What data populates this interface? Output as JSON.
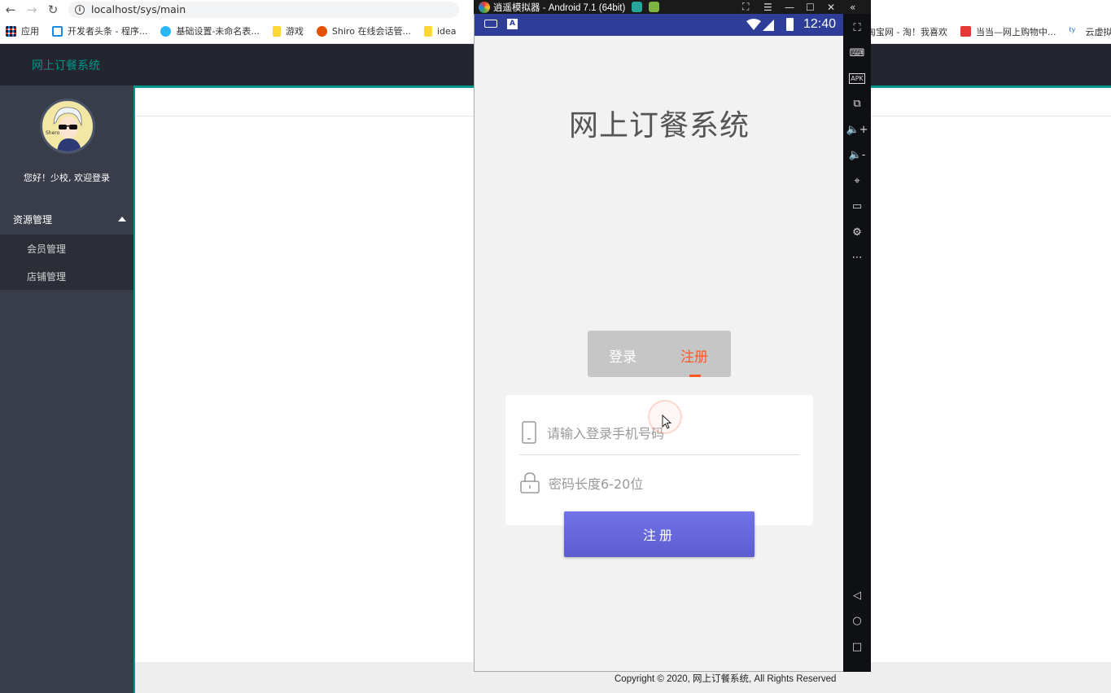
{
  "browser": {
    "url": "localhost/sys/main",
    "bookmarks": [
      {
        "label": "应用",
        "icon": "apps-grid-icon",
        "color": "#e53935"
      },
      {
        "label": "开发者头条 - 程序...",
        "icon": "toutiao-icon",
        "color": "#1e88e5"
      },
      {
        "label": "基础设置-未命名表...",
        "icon": "cloud-icon",
        "color": "#29b6f6"
      },
      {
        "label": "游戏",
        "icon": "folder-icon",
        "color": "#fdd835"
      },
      {
        "label": "Shiro 在线会话管...",
        "icon": "shiro-icon",
        "color": "#e65100"
      },
      {
        "label": "idea",
        "icon": "folder-icon",
        "color": "#fdd835"
      }
    ],
    "bookmarks_right": [
      {
        "label": "淘宝网 - 淘！我喜欢",
        "icon": "taobao-icon",
        "color": "#ff5722"
      },
      {
        "label": "当当—网上购物中...",
        "icon": "dangdang-icon",
        "color": "#e53935"
      },
      {
        "label": "云虚拟",
        "icon": "cloud-tv-icon",
        "color": "#1976d2"
      }
    ]
  },
  "app": {
    "title": "网上订餐系统",
    "accent": "#009688",
    "welcome": "您好！少校, 欢迎登录",
    "menu_group": "资源管理",
    "menu_items": [
      "会员管理",
      "店铺管理"
    ],
    "footer": "Copyright © 2020, 网上订餐系统, All Rights Reserved"
  },
  "emulator": {
    "window_title": "逍遥模拟器 - Android 7.1 (64bit)",
    "status_time": "12:40",
    "status_bar_color": "#2e3d97",
    "app_title": "网上订餐系统",
    "tab_login": "登录",
    "tab_register": "注册",
    "active_tab_color": "#ff5722",
    "phone_placeholder": "请输入登录手机号码",
    "password_placeholder": "密码长度6-20位",
    "submit_label": "注册"
  }
}
